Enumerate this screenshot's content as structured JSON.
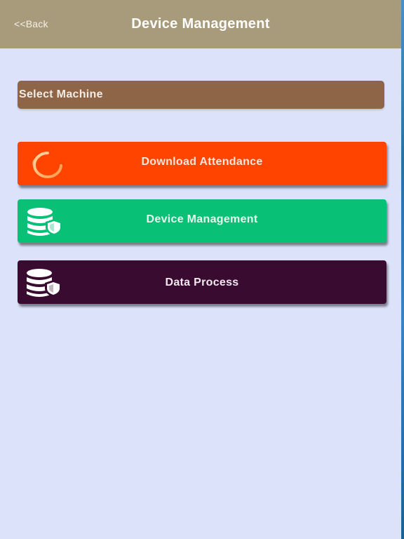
{
  "header": {
    "back_label": "<<Back",
    "title": "Device Management",
    "background": "#a89b7c"
  },
  "select_machine": {
    "label": "Select Machine",
    "background": "#8f6547"
  },
  "actions": [
    {
      "label": "Download Attendance",
      "icon": "loading-spinner-icon",
      "color": "#ff4400"
    },
    {
      "label": "Device Management",
      "icon": "database-shield-icon",
      "color": "#09c176"
    },
    {
      "label": "Data Process",
      "icon": "database-shield-icon",
      "color": "#3a0b31"
    }
  ],
  "colors": {
    "page_background": "#dde2fb"
  }
}
